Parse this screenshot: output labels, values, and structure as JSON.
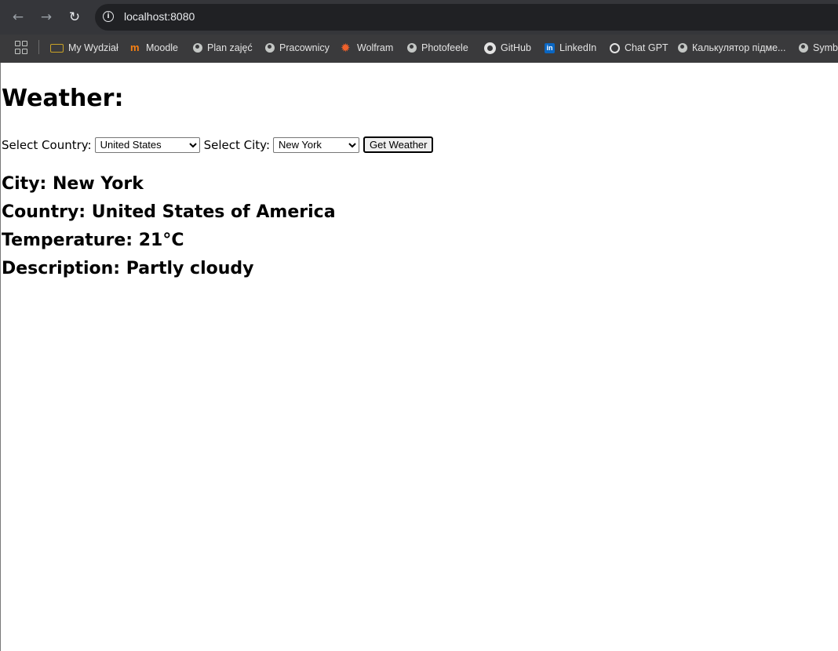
{
  "browser": {
    "nav": {
      "back_icon": "←",
      "forward_icon": "→",
      "reload_icon": "↻"
    },
    "url": "localhost:8080",
    "bookmarks": [
      {
        "label": "My Wydział",
        "icon": "folder-icon"
      },
      {
        "label": "Moodle",
        "icon": "moodle-icon"
      },
      {
        "label": "Plan zajęć",
        "icon": "globe-icon"
      },
      {
        "label": "Pracownicy",
        "icon": "globe-icon"
      },
      {
        "label": "Wolfram",
        "icon": "wolfram-icon"
      },
      {
        "label": "Photofeele",
        "icon": "globe-icon"
      },
      {
        "label": "GitHub",
        "icon": "github-icon"
      },
      {
        "label": "LinkedIn",
        "icon": "linkedin-icon"
      },
      {
        "label": "Chat GPT",
        "icon": "chatgpt-icon"
      },
      {
        "label": "Калькулятор підме...",
        "icon": "globe-icon"
      },
      {
        "label": "Symb",
        "icon": "globe-icon"
      }
    ]
  },
  "page": {
    "title": "Weather:",
    "form": {
      "country_label": "Select Country:",
      "country_value": "United States",
      "city_label": "Select City:",
      "city_value": "New York",
      "button_label": "Get Weather"
    },
    "result": {
      "city": "City: New York",
      "country": "Country: United States of America",
      "temperature": "Temperature: 21°C",
      "description": "Description: Partly cloudy"
    }
  },
  "colors": {
    "toolbar": "#35363a",
    "bookmarks_bar": "#3a3a3c",
    "omnibox": "#202124",
    "page_bg": "#ffffff"
  }
}
